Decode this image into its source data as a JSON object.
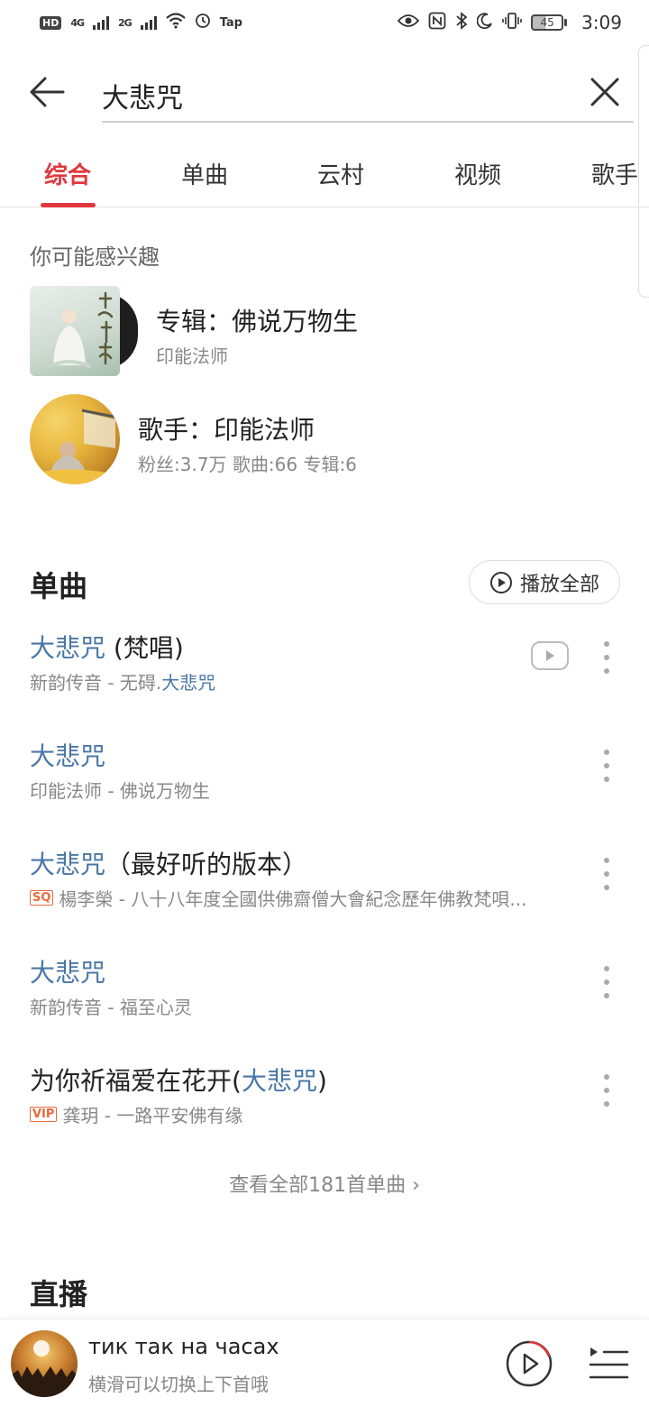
{
  "status_bar": {
    "hd": "HD",
    "sig1": "4G",
    "sig2": "2G",
    "tap": "Tap",
    "battery": "45",
    "time": "3:09"
  },
  "search": {
    "query": "大悲咒"
  },
  "tabs": [
    {
      "label": "综合",
      "active": true
    },
    {
      "label": "单曲"
    },
    {
      "label": "云村"
    },
    {
      "label": "视频"
    },
    {
      "label": "歌手"
    }
  ],
  "interest": {
    "label": "你可能感兴趣",
    "album": {
      "title": "专辑：佛说万物生",
      "artist": "印能法师"
    },
    "artist": {
      "title": "歌手：印能法师",
      "stats": "粉丝:3.7万 歌曲:66 专辑:6"
    }
  },
  "songs_section": {
    "heading": "单曲",
    "play_all": "播放全部",
    "items": [
      {
        "title_hl": "大悲咒",
        "title_rest": " (梵唱)",
        "sub_plain": "新韵传音 - 无碍.",
        "sub_hl": "大悲咒",
        "tag": ""
      },
      {
        "title_hl": "大悲咒",
        "title_rest": "",
        "sub_plain": "印能法师 - 佛说万物生",
        "sub_hl": "",
        "tag": ""
      },
      {
        "title_hl": "大悲咒",
        "title_rest": "（最好听的版本）",
        "sub_plain": "楊李榮 - 八十八年度全國供佛齋僧大會紀念歷年佛教梵唄...",
        "sub_hl": "",
        "tag": "SQ"
      },
      {
        "title_hl": "大悲咒",
        "title_rest": "",
        "sub_plain": "新韵传音 - 福至心灵",
        "sub_hl": "",
        "tag": ""
      },
      {
        "title_pre": "为你祈福爱在花开(",
        "title_hl": "大悲咒",
        "title_rest": ")",
        "sub_plain": "龚玥 - 一路平安佛有缘",
        "sub_hl": "",
        "tag": "VIP"
      }
    ],
    "view_all": "查看全部181首单曲 ›"
  },
  "live": {
    "heading": "直播"
  },
  "mini_player": {
    "title": "тик так на часах",
    "subtitle": "横滑可以切换上下首哦"
  },
  "colors": {
    "accent": "#e0383e",
    "highlight": "#4a78a6",
    "muted": "#888888"
  }
}
